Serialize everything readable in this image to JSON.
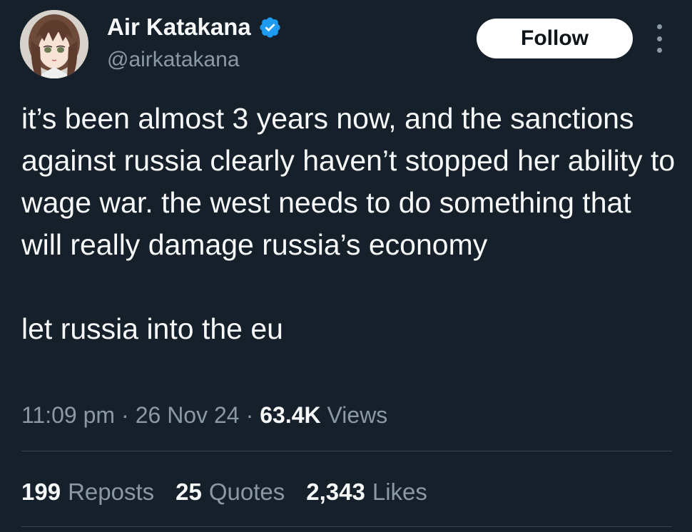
{
  "author": {
    "display_name": "Air Katakana",
    "handle": "@airkatakana",
    "verified": true
  },
  "actions": {
    "follow_label": "Follow",
    "more_icon": "more-vertical-icon"
  },
  "tweet": {
    "paragraphs": [
      "it’s been almost 3 years now, and the sanctions against russia clearly haven’t stopped her ability to wage war. the west needs to do something that will really damage russia’s economy",
      "let russia into the eu"
    ]
  },
  "meta": {
    "time": "11:09 pm",
    "date": "26 Nov 24",
    "views_count": "63.4K",
    "views_label": "Views"
  },
  "stats": {
    "reposts_count": "199",
    "reposts_label": "Reposts",
    "quotes_count": "25",
    "quotes_label": "Quotes",
    "likes_count": "2,343",
    "likes_label": "Likes"
  },
  "colors": {
    "background": "#15202b",
    "text_primary": "#f7f9f9",
    "text_secondary": "#8b98a5",
    "verified_blue": "#1d9bf0",
    "divider": "#38444d"
  }
}
